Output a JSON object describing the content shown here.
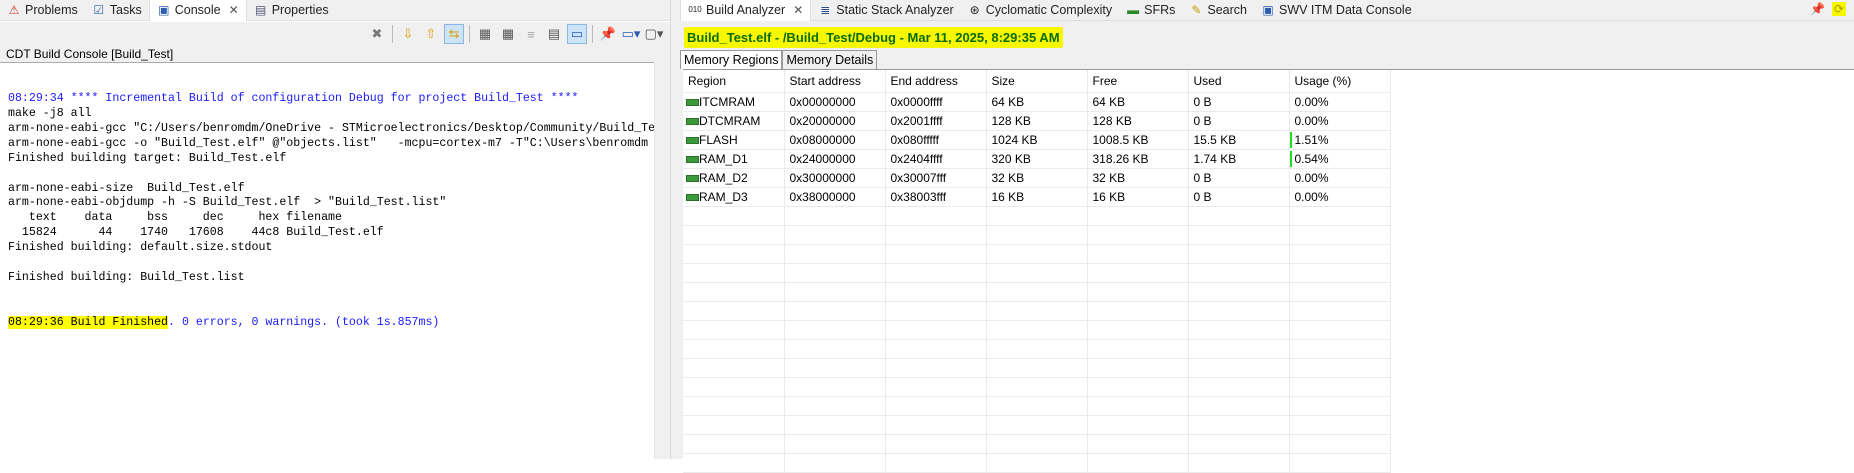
{
  "left": {
    "tabs": [
      {
        "label": "Problems",
        "icon": "problems-icon"
      },
      {
        "label": "Tasks",
        "icon": "tasks-icon"
      },
      {
        "label": "Console",
        "icon": "console-icon",
        "active": true
      },
      {
        "label": "Properties",
        "icon": "properties-icon"
      }
    ],
    "console_title": "CDT Build Console [Build_Test]",
    "lines": [
      "08:29:34 **** Incremental Build of configuration Debug for project Build_Test ****",
      "make -j8 all",
      "arm-none-eabi-gcc \"C:/Users/benromdm/OneDrive - STMicroelectronics/Desktop/Community/Build_Test",
      "arm-none-eabi-gcc -o \"Build_Test.elf\" @\"objects.list\"   -mcpu=cortex-m7 -T\"C:\\Users\\benromdm",
      "Finished building target: Build_Test.elf",
      "",
      "arm-none-eabi-size  Build_Test.elf",
      "arm-none-eabi-objdump -h -S Build_Test.elf  > \"Build_Test.list\"",
      "   text    data     bss     dec     hex filename",
      "  15824      44    1740   17608    44c8 Build_Test.elf",
      "Finished building: default.size.stdout",
      "",
      "Finished building: Build_Test.list",
      "",
      ""
    ],
    "final_highlight": "08:29:36 Build Finished",
    "final_rest": ". 0 errors, 0 warnings. (took 1s.857ms)"
  },
  "right": {
    "tabs": [
      {
        "label": "Build Analyzer",
        "active": true
      },
      {
        "label": "Static Stack Analyzer"
      },
      {
        "label": "Cyclomatic Complexity"
      },
      {
        "label": "SFRs"
      },
      {
        "label": "Search"
      },
      {
        "label": "SWV ITM Data Console"
      }
    ],
    "title": "Build_Test.elf - /Build_Test/Debug - Mar 11, 2025, 8:29:35 AM",
    "subtabs": [
      "Memory Regions",
      "Memory Details"
    ],
    "columns": [
      "Region",
      "Start address",
      "End address",
      "Size",
      "Free",
      "Used",
      "Usage (%)"
    ],
    "rows": [
      {
        "region": "ITCMRAM",
        "start": "0x00000000",
        "end": "0x0000ffff",
        "size": "64 KB",
        "free": "64 KB",
        "used": "0 B",
        "usage": "0.00%",
        "usage_value": 0.0
      },
      {
        "region": "DTCMRAM",
        "start": "0x20000000",
        "end": "0x2001ffff",
        "size": "128 KB",
        "free": "128 KB",
        "used": "0 B",
        "usage": "0.00%",
        "usage_value": 0.0
      },
      {
        "region": "FLASH",
        "start": "0x08000000",
        "end": "0x080fffff",
        "size": "1024 KB",
        "free": "1008.5 KB",
        "used": "15.5 KB",
        "usage": "1.51%",
        "usage_value": 1.51
      },
      {
        "region": "RAM_D1",
        "start": "0x24000000",
        "end": "0x2404ffff",
        "size": "320 KB",
        "free": "318.26 KB",
        "used": "1.74 KB",
        "usage": "0.54%",
        "usage_value": 0.54
      },
      {
        "region": "RAM_D2",
        "start": "0x30000000",
        "end": "0x30007fff",
        "size": "32 KB",
        "free": "32 KB",
        "used": "0 B",
        "usage": "0.00%",
        "usage_value": 0.0
      },
      {
        "region": "RAM_D3",
        "start": "0x38000000",
        "end": "0x38003fff",
        "size": "16 KB",
        "free": "16 KB",
        "used": "0 B",
        "usage": "0.00%",
        "usage_value": 0.0
      }
    ],
    "bar_color": "#22dd22"
  }
}
